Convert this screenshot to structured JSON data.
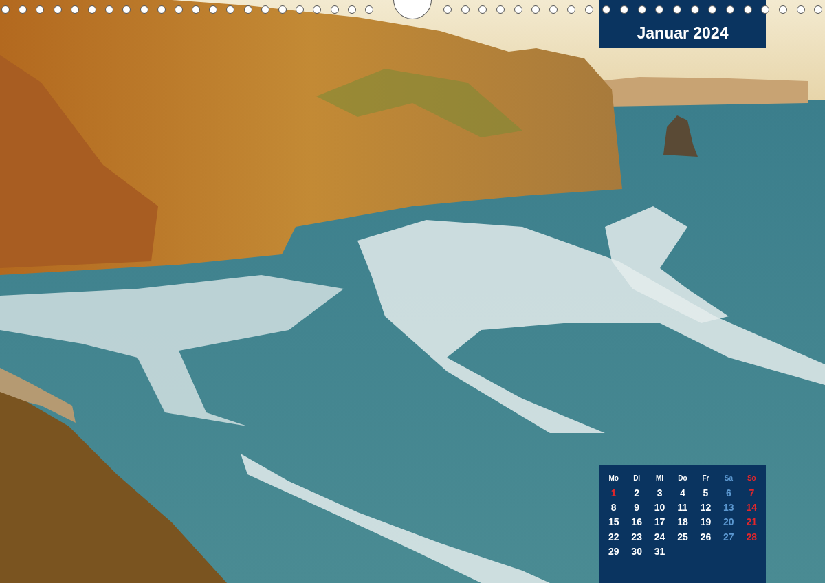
{
  "title": "Januar 2024",
  "calendar": {
    "weekdays": [
      {
        "label": "Mo",
        "color": "#ffffff"
      },
      {
        "label": "Di",
        "color": "#ffffff"
      },
      {
        "label": "Mi",
        "color": "#ffffff"
      },
      {
        "label": "Do",
        "color": "#ffffff"
      },
      {
        "label": "Fr",
        "color": "#ffffff"
      },
      {
        "label": "Sa",
        "color": "#5b97cf"
      },
      {
        "label": "So",
        "color": "#e3262b"
      }
    ],
    "days": [
      {
        "day": "1",
        "color": "#e3262b"
      },
      {
        "day": "2",
        "color": "#ffffff"
      },
      {
        "day": "3",
        "color": "#ffffff"
      },
      {
        "day": "4",
        "color": "#ffffff"
      },
      {
        "day": "5",
        "color": "#ffffff"
      },
      {
        "day": "6",
        "color": "#5b97cf"
      },
      {
        "day": "7",
        "color": "#e3262b"
      },
      {
        "day": "8",
        "color": "#ffffff"
      },
      {
        "day": "9",
        "color": "#ffffff"
      },
      {
        "day": "10",
        "color": "#ffffff"
      },
      {
        "day": "11",
        "color": "#ffffff"
      },
      {
        "day": "12",
        "color": "#ffffff"
      },
      {
        "day": "13",
        "color": "#5b97cf"
      },
      {
        "day": "14",
        "color": "#e3262b"
      },
      {
        "day": "15",
        "color": "#ffffff"
      },
      {
        "day": "16",
        "color": "#ffffff"
      },
      {
        "day": "17",
        "color": "#ffffff"
      },
      {
        "day": "18",
        "color": "#ffffff"
      },
      {
        "day": "19",
        "color": "#ffffff"
      },
      {
        "day": "20",
        "color": "#5b97cf"
      },
      {
        "day": "21",
        "color": "#e3262b"
      },
      {
        "day": "22",
        "color": "#ffffff"
      },
      {
        "day": "23",
        "color": "#ffffff"
      },
      {
        "day": "24",
        "color": "#ffffff"
      },
      {
        "day": "25",
        "color": "#ffffff"
      },
      {
        "day": "26",
        "color": "#ffffff"
      },
      {
        "day": "27",
        "color": "#5b97cf"
      },
      {
        "day": "28",
        "color": "#e3262b"
      },
      {
        "day": "29",
        "color": "#ffffff"
      },
      {
        "day": "30",
        "color": "#ffffff"
      },
      {
        "day": "31",
        "color": "#ffffff"
      }
    ]
  }
}
